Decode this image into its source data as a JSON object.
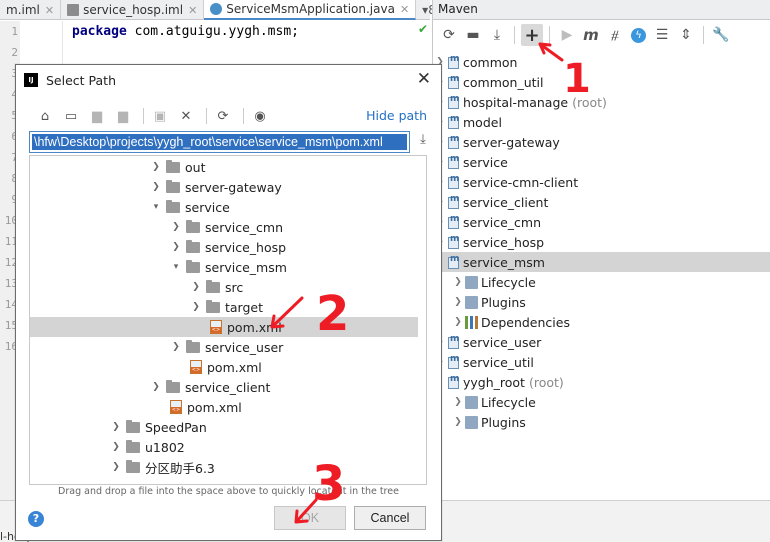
{
  "editor": {
    "tabs": [
      {
        "label": "m.iml"
      },
      {
        "label": "service_hosp.iml"
      },
      {
        "label": "ServiceMsmApplication.java"
      }
    ],
    "more_tabs": "▾8",
    "line_numbers": [
      "1",
      "2",
      "3",
      "4",
      "5",
      "6",
      "7",
      "8",
      "9",
      "10",
      "11",
      "12",
      "13",
      "14",
      "15",
      "16"
    ],
    "code_line_1": {
      "keyword": "package",
      "rest": "com.atguigu.yygh.msm;"
    },
    "status_fragment": "l-hosp"
  },
  "maven": {
    "title": "Maven",
    "toolbar_icons": [
      "refresh-icon",
      "folder-icon",
      "download-icon",
      "add-icon",
      "run-icon",
      "maven-goal-icon",
      "toggle-offline-icon",
      "skip-tests-icon",
      "collapse-icon",
      "expand-icon",
      "wrench-icon"
    ],
    "tree": [
      {
        "label": "common",
        "type": "module",
        "note": ""
      },
      {
        "label": "common_util",
        "type": "module",
        "note": ""
      },
      {
        "label": "hospital-manage",
        "type": "module",
        "note": "(root)"
      },
      {
        "label": "model",
        "type": "module",
        "note": ""
      },
      {
        "label": "server-gateway",
        "type": "module",
        "note": ""
      },
      {
        "label": "service",
        "type": "module",
        "note": ""
      },
      {
        "label": "service-cmn-client",
        "type": "module",
        "note": ""
      },
      {
        "label": "service_client",
        "type": "module",
        "note": ""
      },
      {
        "label": "service_cmn",
        "type": "module",
        "note": ""
      },
      {
        "label": "service_hosp",
        "type": "module",
        "note": ""
      },
      {
        "label": "service_msm",
        "type": "module",
        "note": "",
        "selected": true,
        "expanded": true
      },
      {
        "label": "Lifecycle",
        "type": "config",
        "note": "",
        "indent": 1
      },
      {
        "label": "Plugins",
        "type": "config",
        "note": "",
        "indent": 1
      },
      {
        "label": "Dependencies",
        "type": "deps",
        "note": "",
        "indent": 1
      },
      {
        "label": "service_user",
        "type": "module",
        "note": ""
      },
      {
        "label": "service_util",
        "type": "module",
        "note": ""
      },
      {
        "label": "yygh_root",
        "type": "module",
        "note": "(root)",
        "expanded": true
      },
      {
        "label": "Lifecycle",
        "type": "config",
        "note": "",
        "indent": 1
      },
      {
        "label": "Plugins",
        "type": "config",
        "note": "",
        "indent": 1
      }
    ]
  },
  "dialog": {
    "title": "Select Path",
    "app_icon_text": "IJ",
    "hide_path_label": "Hide path",
    "path_value": "\\hfw\\Desktop\\projects\\yygh_root\\service\\service_msm\\pom.xml",
    "toolbar_icons": [
      "home-icon",
      "desktop-icon",
      "project-folder-icon",
      "module-folder-icon",
      "new-folder-icon",
      "delete-icon",
      "refresh-icon",
      "show-hidden-icon"
    ],
    "tree": [
      {
        "label": "out",
        "type": "folder",
        "level": 6,
        "arrow": "right"
      },
      {
        "label": "server-gateway",
        "type": "folder",
        "level": 6,
        "arrow": "right"
      },
      {
        "label": "service",
        "type": "folder",
        "level": 6,
        "arrow": "down"
      },
      {
        "label": "service_cmn",
        "type": "folder",
        "level": 7,
        "arrow": "right"
      },
      {
        "label": "service_hosp",
        "type": "folder",
        "level": 7,
        "arrow": "right"
      },
      {
        "label": "service_msm",
        "type": "folder",
        "level": 7,
        "arrow": "down"
      },
      {
        "label": "src",
        "type": "folder",
        "level": 8,
        "arrow": "right"
      },
      {
        "label": "target",
        "type": "folder",
        "level": 8,
        "arrow": "right"
      },
      {
        "label": "pom.xml",
        "type": "xml",
        "level": 8,
        "arrow": "",
        "selected": true
      },
      {
        "label": "service_user",
        "type": "folder",
        "level": 7,
        "arrow": "right"
      },
      {
        "label": "pom.xml",
        "type": "xml",
        "level": 7,
        "arrow": ""
      },
      {
        "label": "service_client",
        "type": "folder",
        "level": 6,
        "arrow": "right"
      },
      {
        "label": "pom.xml",
        "type": "xml",
        "level": 6,
        "arrow": ""
      },
      {
        "label": "SpeedPan",
        "type": "folder",
        "level": 4,
        "arrow": "right"
      },
      {
        "label": "u1802",
        "type": "folder",
        "level": 4,
        "arrow": "right"
      },
      {
        "label": "分区助手6.3",
        "type": "folder",
        "level": 4,
        "arrow": "right"
      }
    ],
    "hint": "Drag and drop a file into the space above to quickly locate it in the tree",
    "ok_label": "OK",
    "cancel_label": "Cancel",
    "help_label": "?"
  },
  "annotations": {
    "step_1": "1",
    "step_2": "2",
    "step_3": "3",
    "color": "#ee1c24"
  }
}
